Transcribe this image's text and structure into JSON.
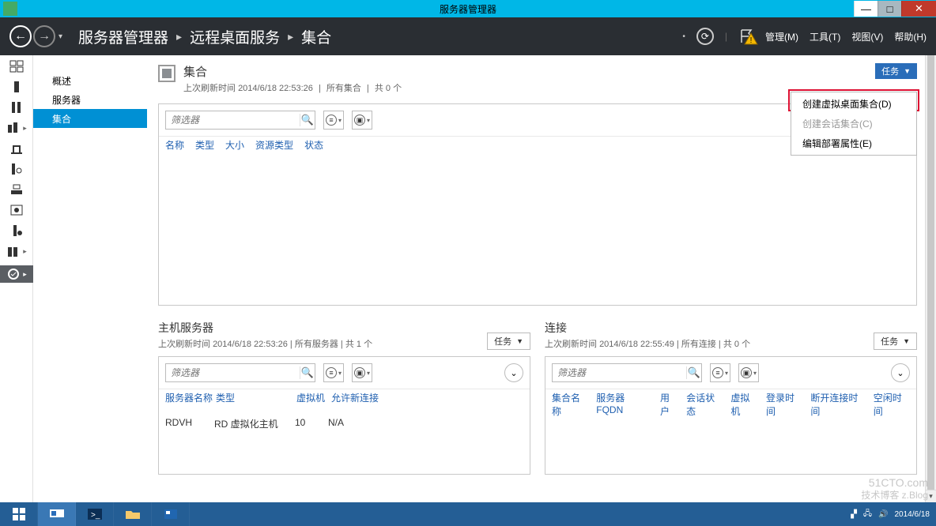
{
  "window": {
    "title": "服务器管理器"
  },
  "breadcrumbs": {
    "b0": "服务器管理器",
    "b1": "远程桌面服务",
    "b2": "集合"
  },
  "menu": {
    "manage": "管理(M)",
    "tools": "工具(T)",
    "view": "视图(V)",
    "help": "帮助(H)"
  },
  "sidenav": {
    "overview": "概述",
    "servers": "服务器",
    "collections": "集合"
  },
  "panel_main": {
    "title": "集合",
    "sub_prefix": "上次刷新时间",
    "sub_time": "2014/6/18 22:53:26",
    "sub_scope": "所有集合",
    "sub_count": "共 0 个",
    "tasks": "任务",
    "filter_ph": "筛选器",
    "cols": {
      "name": "名称",
      "type": "类型",
      "size": "大小",
      "restype": "资源类型",
      "status": "状态"
    }
  },
  "ctxmenu": {
    "m1": "创建虚拟桌面集合(D)",
    "m2": "创建会话集合(C)",
    "m3": "编辑部署属性(E)"
  },
  "panel_hosts": {
    "title": "主机服务器",
    "sub_time": "2014/6/18 22:53:26",
    "sub_scope": "所有服务器",
    "sub_count": "共 1 个",
    "cols": {
      "name": "服务器名称",
      "type": "类型",
      "vm": "虚拟机",
      "allow": "允许新连接"
    },
    "row": {
      "name": "RDVH",
      "type": "RD 虚拟化主机",
      "vm": "10",
      "allow": "N/A"
    }
  },
  "panel_conn": {
    "title": "连接",
    "sub_time": "2014/6/18 22:55:49",
    "sub_scope": "所有连接",
    "sub_count": "共 0 个",
    "cols": {
      "c1": "集合名称",
      "c2": "服务器 FQDN",
      "c3": "用户",
      "c4": "会话状态",
      "c5": "虚拟机",
      "c6": "登录时间",
      "c7": "断开连接时间",
      "c8": "空闲时间"
    }
  },
  "watermark": {
    "l1": "51CTO.com",
    "l2": "技术博客 z.Blog"
  },
  "tray": {
    "date": "2014/6/18"
  }
}
